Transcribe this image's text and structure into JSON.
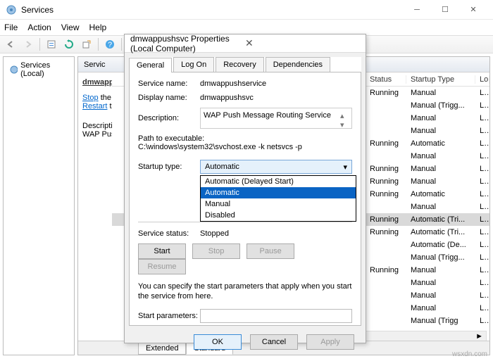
{
  "window": {
    "title": "Services"
  },
  "menu": [
    "File",
    "Action",
    "View",
    "Help"
  ],
  "left_panel": {
    "item": "Services (Local)"
  },
  "detail": {
    "header": "Servic",
    "svcname": "dmwappusl",
    "stop_link": "Stop",
    "stop_rest": " the ser",
    "restart_link": "Restart",
    "restart_rest": " the s",
    "desc_label": "Description:",
    "desc_text": "WAP Push M"
  },
  "table": {
    "headers": {
      "status": "Status",
      "startup": "Startup Type",
      "logon": "Lo"
    },
    "rows": [
      {
        "status": "Running",
        "startup": "Manual",
        "logon": "Lo"
      },
      {
        "status": "",
        "startup": "Manual (Trigg...",
        "logon": "Lo"
      },
      {
        "status": "",
        "startup": "Manual",
        "logon": "Lo"
      },
      {
        "status": "",
        "startup": "Manual",
        "logon": "Lo"
      },
      {
        "status": "Running",
        "startup": "Automatic",
        "logon": "Lo"
      },
      {
        "status": "",
        "startup": "Manual",
        "logon": "Lo"
      },
      {
        "status": "Running",
        "startup": "Manual",
        "logon": "Lo"
      },
      {
        "status": "Running",
        "startup": "Manual",
        "logon": "Lo"
      },
      {
        "status": "Running",
        "startup": "Automatic",
        "logon": "Lo"
      },
      {
        "status": "",
        "startup": "Manual",
        "logon": "Lo"
      },
      {
        "status": "Running",
        "startup": "Automatic (Tri...",
        "logon": "Lo",
        "sel": true
      },
      {
        "status": "Running",
        "startup": "Automatic (Tri...",
        "logon": "Lo"
      },
      {
        "status": "",
        "startup": "Automatic (De...",
        "logon": "Lo"
      },
      {
        "status": "",
        "startup": "Manual (Trigg...",
        "logon": "Lo"
      },
      {
        "status": "Running",
        "startup": "Manual",
        "logon": "Lo"
      },
      {
        "status": "",
        "startup": "Manual",
        "logon": "Lo"
      },
      {
        "status": "",
        "startup": "Manual",
        "logon": "Lo"
      },
      {
        "status": "",
        "startup": "Manual",
        "logon": "Lo"
      },
      {
        "status": "",
        "startup": "Manual (Trigg",
        "logon": "Lo"
      }
    ]
  },
  "bottom_tabs": {
    "extended": "Extended",
    "standard": "Standard"
  },
  "dialog": {
    "title": "dmwappushsvc Properties (Local Computer)",
    "tabs": [
      "General",
      "Log On",
      "Recovery",
      "Dependencies"
    ],
    "service_name_lbl": "Service name:",
    "service_name": "dmwappushservice",
    "display_name_lbl": "Display name:",
    "display_name": "dmwappushsvc",
    "description_lbl": "Description:",
    "description": "WAP Push Message Routing Service",
    "path_lbl": "Path to executable:",
    "path": "C:\\windows\\system32\\svchost.exe -k netsvcs -p",
    "startup_lbl": "Startup type:",
    "startup_value": "Automatic",
    "dropdown": [
      "Automatic (Delayed Start)",
      "Automatic",
      "Manual",
      "Disabled"
    ],
    "dropdown_sel": 1,
    "service_status_lbl": "Service status:",
    "service_status": "Stopped",
    "btns": {
      "start": "Start",
      "stop": "Stop",
      "pause": "Pause",
      "resume": "Resume"
    },
    "hint": "You can specify the start parameters that apply when you start the service from here.",
    "start_params_lbl": "Start parameters:",
    "ok": "OK",
    "cancel": "Cancel",
    "apply": "Apply"
  },
  "watermark": "wsxdn.com"
}
